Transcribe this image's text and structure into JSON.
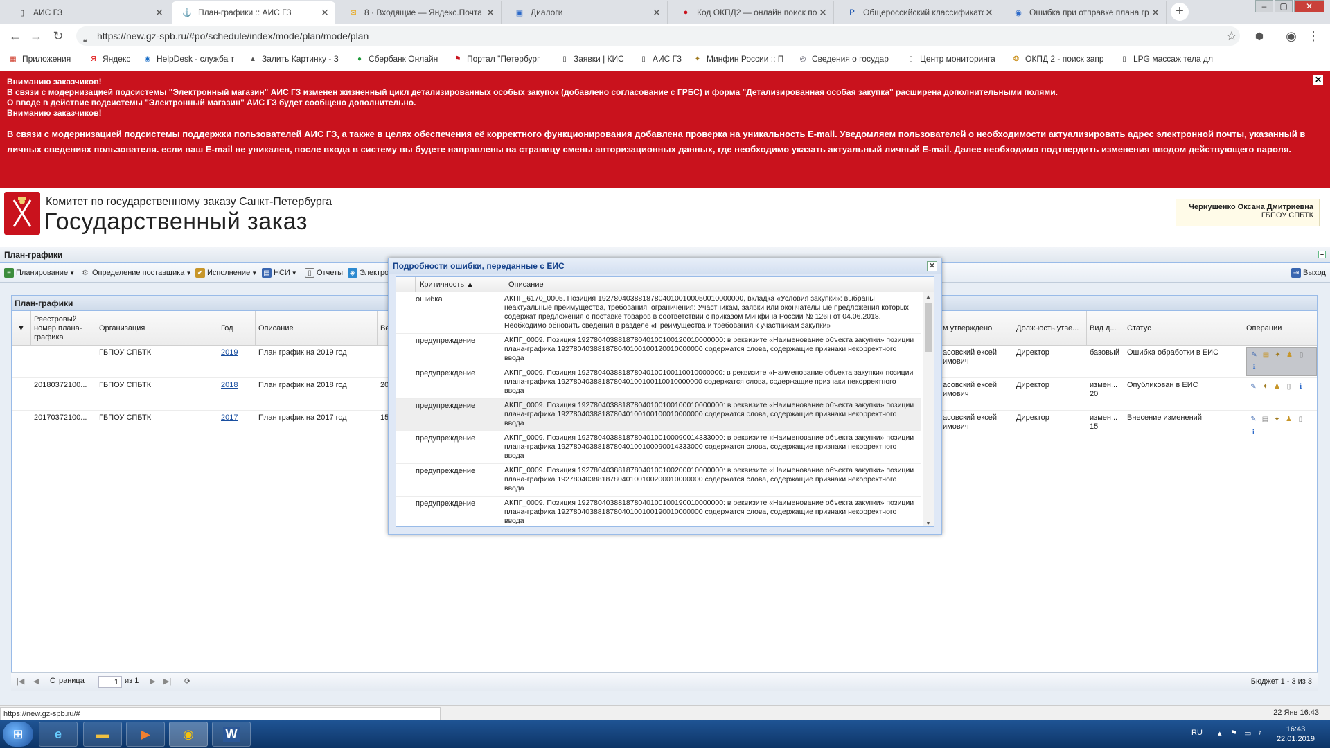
{
  "browser": {
    "tabs": [
      {
        "label": "АИС ГЗ",
        "icon": "page-icon",
        "active": false
      },
      {
        "label": "План-графики :: АИС ГЗ",
        "icon": "spb-logo-icon",
        "active": true
      },
      {
        "label": "8 · Входящие — Яндекс.Почта",
        "icon": "mail-icon",
        "active": false
      },
      {
        "label": "Диалоги",
        "icon": "chat-icon",
        "active": false
      },
      {
        "label": "Код ОКПД2 — онлайн поиск по",
        "icon": "okpd-icon",
        "active": false
      },
      {
        "label": "Общероссийский классификато",
        "icon": "rz-icon",
        "active": false
      },
      {
        "label": "Ошибка при отправке плана гр",
        "icon": "globe-icon",
        "active": false
      }
    ],
    "url": "https://new.gz-spb.ru/#po/schedule/index/mode/plan/mode/plan",
    "bookmarks": [
      {
        "label": "Приложения",
        "icon": "apps-icon"
      },
      {
        "label": "Яндекс",
        "icon": "yandex-icon"
      },
      {
        "label": "HelpDesk - служба т",
        "icon": "helpdesk-icon"
      },
      {
        "label": "Залить Картинку - З",
        "icon": "image-upload-icon"
      },
      {
        "label": "Сбербанк Онлайн",
        "icon": "sberbank-icon"
      },
      {
        "label": "Портал \"Петербург",
        "icon": "spb-portal-icon"
      },
      {
        "label": "Заявки | КИС",
        "icon": "page-icon"
      },
      {
        "label": "АИС ГЗ",
        "icon": "page-icon"
      },
      {
        "label": "Минфин России :: П",
        "icon": "minfin-icon"
      },
      {
        "label": "Сведения о государ",
        "icon": "gov-icon"
      },
      {
        "label": "Центр мониторинга",
        "icon": "page-icon"
      },
      {
        "label": "ОКПД 2 - поиск запр",
        "icon": "okpd-icon"
      },
      {
        "label": "LPG массаж тела дл",
        "icon": "page-icon"
      }
    ]
  },
  "banner": {
    "line1": "Вниманию заказчиков!",
    "line2": "В связи с модернизацией подсистемы \"Электронный магазин\" АИС ГЗ изменен жизненный цикл детализированных особых закупок (добавлено согласование с ГРБС) и форма \"Детализированная особая закупка\" расширена дополнительными полями.",
    "line3": "О вводе в действие подсистемы \"Электронный магазин\" АИС ГЗ будет сообщено дополнительно.",
    "line4": "Вниманию заказчиков!",
    "line5": "В связи с модернизацией подсистемы поддержки пользователей АИС ГЗ, а также в целях обеспечения её корректного функционирования добавлена проверка на уникальность E-mail. Уведомляем пользователей о необходимости актуализировать адрес электронной почты, указанный в личных сведениях пользователя. если ваш E-mail не уникален, после входа в систему вы будете направлены на страницу смены авторизационных данных, где необходимо указать актуальный личный E-mail. Далее необходимо подтвердить изменения вводом действующего пароля."
  },
  "header": {
    "committee": "Комитет по государственному заказу Санкт-Петербурга",
    "title": "Государственный заказ",
    "user_name": "Чернушенко Оксана Дмитриевна",
    "user_org": "ГБПОУ СПБТК"
  },
  "panel": {
    "title": "План-графики",
    "toolbar": [
      {
        "label": "Планирование",
        "icon": "planning-icon",
        "menu": true
      },
      {
        "label": "Определение поставщика",
        "icon": "supplier-icon",
        "menu": true
      },
      {
        "label": "Исполнение",
        "icon": "execution-icon",
        "menu": true
      },
      {
        "label": "НСИ",
        "icon": "nsi-icon",
        "menu": true
      },
      {
        "label": "Отчеты",
        "icon": "reports-icon",
        "menu": false
      },
      {
        "label": "Электро",
        "icon": "electronic-icon",
        "menu": false
      }
    ],
    "exit_label": "Выход"
  },
  "grid": {
    "title": "План-графики",
    "columns": {
      "reg_number": "Реестровый номер плана-графика",
      "org": "Организация",
      "year": "Год",
      "desc": "Описание",
      "ver": "Ве",
      "approved": "м утверждено",
      "position": "Должность утве...",
      "kind": "Вид д...",
      "status": "Статус",
      "ops": "Операции"
    },
    "rows": [
      {
        "reg_number": "",
        "org": "ГБПОУ СПБТК",
        "year": "2019",
        "desc": "План график на 2019 год",
        "ver": "",
        "approved": "асовский ексей имович",
        "position": "Директор",
        "kind": "базовый",
        "status": "Ошибка обработки в ЕИС"
      },
      {
        "reg_number": "20180372100...",
        "org": "ГБПОУ СПБТК",
        "year": "2018",
        "desc": "План график на 2018 год",
        "ver": "20",
        "approved": "асовский ексей имович",
        "position": "Директор",
        "kind": "измен... 20",
        "status": "Опубликован в ЕИС"
      },
      {
        "reg_number": "20170372100...",
        "org": "ГБПОУ СПБТК",
        "year": "2017",
        "desc": "План график на 2017 год",
        "ver": "15",
        "approved": "асовский ексей имович",
        "position": "Директор",
        "kind": "измен... 15",
        "status": "Внесение изменений"
      }
    ]
  },
  "pager": {
    "page_label": "Страница",
    "page_value": "1",
    "of_label": "из 1",
    "summary": "Бюджет 1 - 3 из 3"
  },
  "modal": {
    "title": "Подробности ошибки, переданные с ЕИС",
    "col_crit": "Критичность ▲",
    "col_desc": "Описание",
    "rows": [
      {
        "crit": "ошибка",
        "desc": "АКПГ_6170_0005. Позиция 192780403881878040100100050010000000, вкладка «Условия закупки»: выбраны неактуальные преимущества, требования, ограничения: Участникам, заявки или окончательные предложения которых содержат предложения о поставке товаров в соответствии с приказом Минфина России № 126н от 04.06.2018. Необходимо обновить сведения в разделе «Преимущества и требования к участникам закупки»"
      },
      {
        "crit": "предупреждение",
        "desc": "АКПГ_0009. Позиция 192780403881878040100100120010000000: в реквизите «Наименование объекта закупки» позиции плана-графика 192780403881878040100100120010000000 содержатся слова, содержащие признаки некорректного ввода"
      },
      {
        "crit": "предупреждение",
        "desc": "АКПГ_0009. Позиция 192780403881878040100100110010000000: в реквизите «Наименование объекта закупки» позиции плана-графика 192780403881878040100100110010000000 содержатся слова, содержащие признаки некорректного ввода"
      },
      {
        "crit": "предупреждение",
        "desc": "АКПГ_0009. Позиция 192780403881878040100100100010000000: в реквизите «Наименование объекта закупки» позиции плана-графика 192780403881878040100100100010000000 содержатся слова, содержащие признаки некорректного ввода"
      },
      {
        "crit": "предупреждение",
        "desc": "АКПГ_0009. Позиция 192780403881878040100100090014333000: в реквизите «Наименование объекта закупки» позиции плана-графика 192780403881878040100100090014333000 содержатся слова, содержащие признаки некорректного ввода"
      },
      {
        "crit": "предупреждение",
        "desc": "АКПГ_0009. Позиция 192780403881878040100100200010000000: в реквизите «Наименование объекта закупки» позиции плана-графика 192780403881878040100100200010000000 содержатся слова, содержащие признаки некорректного ввода"
      },
      {
        "crit": "предупреждение",
        "desc": "АКПГ_0009. Позиция 192780403881878040100100190010000000: в реквизите «Наименование объекта закупки» позиции плана-графика 192780403881878040100100190010000000 содержатся слова, содержащие признаки некорректного ввода"
      }
    ]
  },
  "status": {
    "url": "https://new.gz-spb.ru/#",
    "date": "22 Янв 16:43"
  },
  "taskbar": {
    "lang": "RU",
    "time": "16:43",
    "date": "22.01.2019"
  },
  "colors": {
    "banner": "#c9121d",
    "grid_border": "#99bbe8",
    "taskbar": "#1f5494"
  }
}
